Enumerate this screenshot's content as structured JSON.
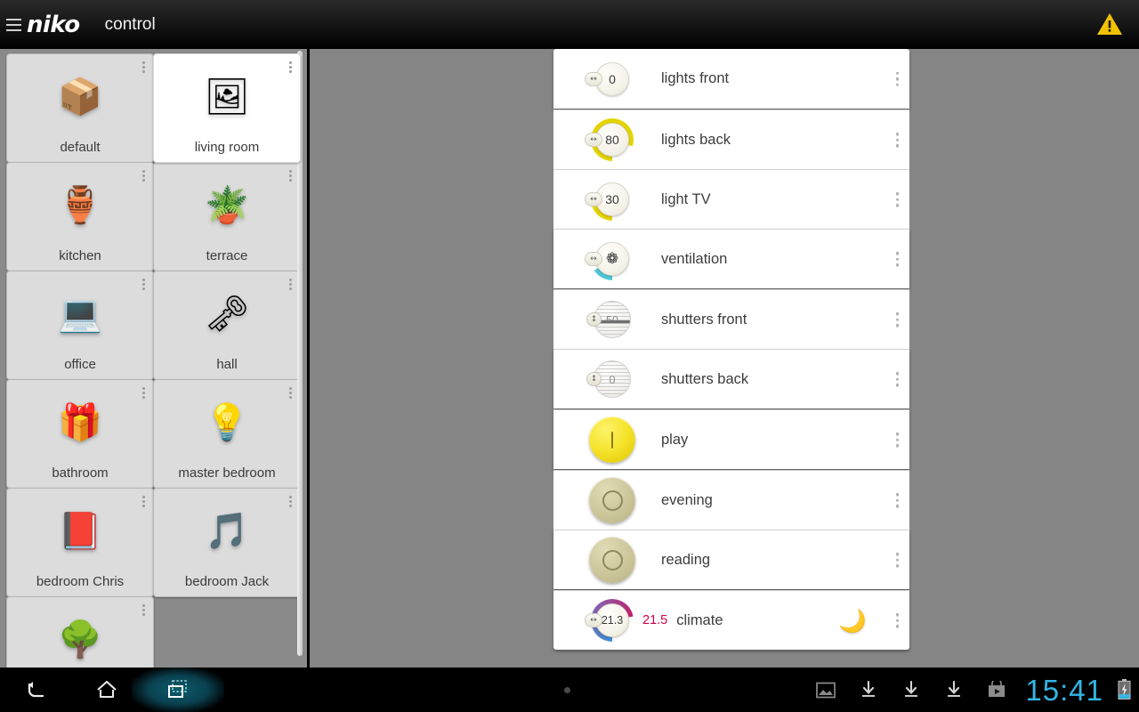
{
  "appbar": {
    "menu_icon": "hamburger-icon",
    "brand": "niko",
    "title": "control",
    "warning_icon": "warning-triangle-icon"
  },
  "sidebar": {
    "tiles": [
      {
        "label": "default",
        "emoji": "📦",
        "icon_name": "box-icon",
        "selected": false
      },
      {
        "label": "living room",
        "emoji": "🖼",
        "icon_name": "framed-picture-icon",
        "selected": true
      },
      {
        "label": "kitchen",
        "emoji": "🏺",
        "icon_name": "vase-icon",
        "selected": false
      },
      {
        "label": "terrace",
        "emoji": "🪴",
        "icon_name": "potted-plant-icon",
        "selected": false
      },
      {
        "label": "office",
        "emoji": "💻",
        "icon_name": "laptop-icon",
        "selected": false
      },
      {
        "label": "hall",
        "emoji": "🗝",
        "icon_name": "keys-icon",
        "selected": false
      },
      {
        "label": "bathroom",
        "emoji": "🎁",
        "icon_name": "gift-icon",
        "selected": false
      },
      {
        "label": "master bedroom",
        "emoji": "💡",
        "icon_name": "lamp-icon",
        "selected": false
      },
      {
        "label": "bedroom Chris",
        "emoji": "📕",
        "icon_name": "book-icon",
        "selected": false
      },
      {
        "label": "bedroom Jack",
        "emoji": "🎵",
        "icon_name": "music-note-icon",
        "selected": false
      },
      {
        "label": "",
        "emoji": "🌳",
        "icon_name": "tree-icon",
        "selected": false
      }
    ]
  },
  "list": {
    "overflow_icon": "three-dot-overflow-icon",
    "rows": [
      {
        "name": "lights front",
        "type": "dimmer",
        "value": "0",
        "arc_percent": 0,
        "arc_color": "#e4d400",
        "icon_name": "dimmer-dial-icon",
        "handle": "↔"
      },
      {
        "name": "lights back",
        "type": "dimmer",
        "value": "80",
        "arc_percent": 80,
        "arc_color": "#e4d400",
        "icon_name": "dimmer-dial-icon",
        "handle": "↔"
      },
      {
        "name": "light TV",
        "type": "dimmer",
        "value": "30",
        "arc_percent": 30,
        "arc_color": "#e4d400",
        "icon_name": "dimmer-dial-icon",
        "handle": "↔"
      },
      {
        "name": "ventilation",
        "type": "fan",
        "value": "",
        "arc_percent": 16,
        "arc_color": "#4ec8d8",
        "icon_name": "fan-dial-icon",
        "handle": "↔",
        "glyph": "❁"
      },
      {
        "name": "shutters front",
        "type": "shutter",
        "value": "50",
        "position": 50,
        "icon_name": "shutter-dial-icon",
        "handle": "↕"
      },
      {
        "name": "shutters back",
        "type": "shutter",
        "value": "0",
        "position": 0,
        "icon_name": "shutter-dial-icon",
        "handle": "↕"
      },
      {
        "name": "play",
        "type": "scene",
        "state": "on",
        "icon_name": "scene-button-on-icon"
      },
      {
        "name": "evening",
        "type": "scene",
        "state": "off",
        "icon_name": "scene-button-off-icon"
      },
      {
        "name": "reading",
        "type": "scene",
        "state": "off",
        "icon_name": "scene-button-off-icon"
      },
      {
        "name": "climate",
        "type": "thermostat",
        "value": "21.3",
        "setpoint": "21.5",
        "arc_start_color": "#3f8fd8",
        "arc_end_color": "#c41c6b",
        "icon_name": "thermostat-dial-icon",
        "handle": "↔",
        "mode_icon": "moon-icon",
        "mode_glyph": "🌙"
      }
    ]
  },
  "navbar": {
    "back_icon": "back-arrow-icon",
    "home_icon": "home-icon",
    "recents_icon": "recent-apps-icon",
    "status_icons": [
      "image-icon",
      "download-icon",
      "download-icon",
      "download-icon",
      "play-store-icon"
    ],
    "clock": "15:41",
    "battery_icon": "battery-charging-icon"
  },
  "colors": {
    "background": "#858585",
    "accent_yellow": "#e4d400",
    "accent_cyan": "#4ec8d8",
    "setpoint_red": "#d1004b",
    "clock_cyan": "#33b5e5",
    "warning_yellow": "#f2c200"
  }
}
